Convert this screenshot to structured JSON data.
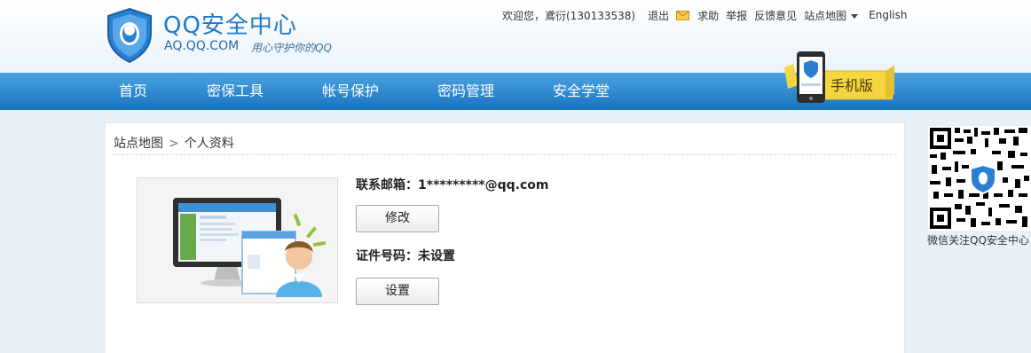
{
  "header": {
    "logo_title": "QQ安全中心",
    "logo_domain": "AQ.QQ.COM",
    "logo_slogan": "用心守护你的QQ",
    "welcome": "欢迎您，鳶衍(130133538)",
    "links": {
      "logout": "退出",
      "help": "求助",
      "report": "举报",
      "feedback": "反馈意见",
      "sitemap": "站点地图",
      "english": "English"
    }
  },
  "nav": {
    "items": [
      "首页",
      "密保工具",
      "帐号保护",
      "密码管理",
      "安全学堂"
    ],
    "mobile_label": "手机版"
  },
  "breadcrumb": {
    "root": "站点地图",
    "separator": ">",
    "current": "个人资料"
  },
  "profile": {
    "email_label": "联系邮箱：",
    "email_value": "1*********@qq.com",
    "modify_button": "修改",
    "id_label": "证件号码：",
    "id_value": "未设置",
    "set_button": "设置"
  },
  "qr": {
    "caption": "微信关注QQ安全中心"
  },
  "colors": {
    "brand_blue": "#1f79c8",
    "nav_blue": "#2a86d0",
    "badge_yellow": "#f6d640"
  }
}
